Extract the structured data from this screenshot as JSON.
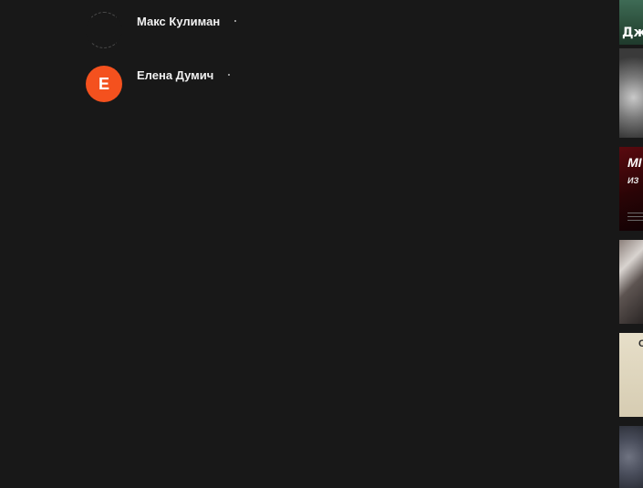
{
  "users": [
    {
      "name": "Макс Кулиман",
      "avatar_letter": "",
      "avatar_color": ""
    },
    {
      "name": "Елена Думич",
      "avatar_letter": "Е",
      "avatar_color": "#f4511e"
    }
  ],
  "shelf": [
    {
      "caption": "Дж",
      "icon": "video-thumbnail"
    },
    {
      "caption": "",
      "icon": "video-thumbnail"
    },
    {
      "caption": "МІ",
      "caption2": "ИЗ",
      "icon": "video-thumbnail"
    },
    {
      "caption": "",
      "icon": "video-thumbnail"
    },
    {
      "caption": "С",
      "icon": "video-thumbnail"
    },
    {
      "caption": "",
      "icon": "video-thumbnail"
    }
  ]
}
